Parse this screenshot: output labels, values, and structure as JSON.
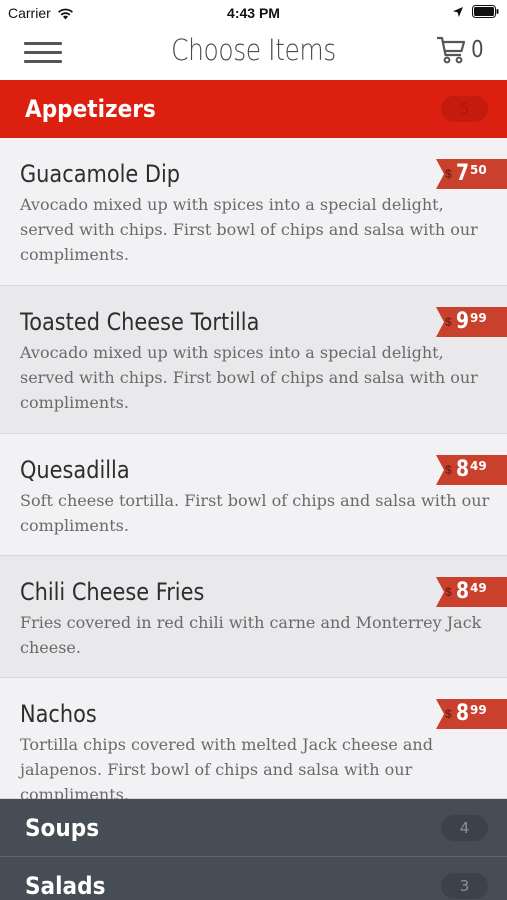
{
  "status_bar": {
    "carrier": "Carrier",
    "time": "4:43 PM",
    "wifi_icon": "wifi-icon",
    "location_icon": "location-arrow-icon",
    "battery_icon": "battery-icon"
  },
  "nav": {
    "title": "Choose Items",
    "menu_icon": "hamburger-menu-icon",
    "cart_icon": "shopping-cart-icon",
    "cart_count": "0"
  },
  "categories": [
    {
      "label": "Appetizers",
      "count": "5",
      "color": "#dc2010"
    },
    {
      "label": "Soups",
      "count": "4",
      "color": "#464d55"
    },
    {
      "label": "Salads",
      "count": "3",
      "color": "#464d55"
    }
  ],
  "items": [
    {
      "name": "Guacamole Dip",
      "description": "Avocado mixed up with spices into a special delight, served with chips. First bowl of chips and salsa with our compliments.",
      "currency": "$",
      "price_main": "7",
      "price_cents": "50"
    },
    {
      "name": "Toasted Cheese Tortilla",
      "description": "Avocado mixed up with spices into a special delight, served with chips. First bowl of chips and salsa with our compliments.",
      "currency": "$",
      "price_main": "9",
      "price_cents": "99"
    },
    {
      "name": "Quesadilla",
      "description": "Soft cheese tortilla. First bowl of chips and salsa with our compliments.",
      "currency": "$",
      "price_main": "8",
      "price_cents": "49"
    },
    {
      "name": "Chili Cheese Fries",
      "description": "Fries covered in red chili with carne and Monterrey Jack cheese.",
      "currency": "$",
      "price_main": "8",
      "price_cents": "49"
    },
    {
      "name": "Nachos",
      "description": "Tortilla chips covered with melted Jack cheese and jalapenos. First bowl of chips and salsa with our compliments.",
      "currency": "$",
      "price_main": "8",
      "price_cents": "99"
    }
  ],
  "colors": {
    "accent": "#dc2010",
    "price_tag": "#c9402c",
    "dark_category": "#464d55"
  }
}
